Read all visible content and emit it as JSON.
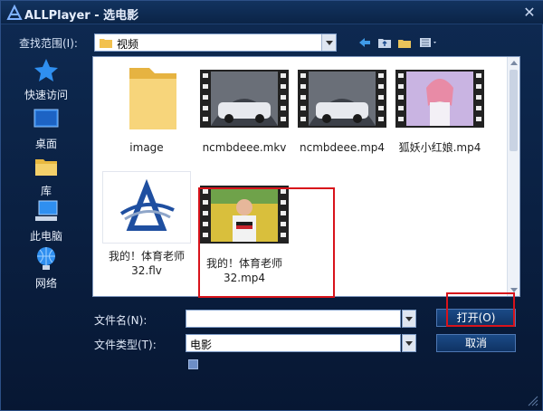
{
  "window": {
    "title": "ALLPlayer - 选电影"
  },
  "toolbar": {
    "look_in_label": "查找范围(I):",
    "current_folder": "视频"
  },
  "sidebar": {
    "items": [
      {
        "label": "快速访问",
        "icon": "star-icon"
      },
      {
        "label": "桌面",
        "icon": "desktop-icon"
      },
      {
        "label": "库",
        "icon": "library-icon"
      },
      {
        "label": "此电脑",
        "icon": "computer-icon"
      },
      {
        "label": "网络",
        "icon": "network-icon"
      }
    ]
  },
  "files": [
    {
      "name": "image",
      "type": "folder"
    },
    {
      "name": "ncmbdeee.mkv",
      "type": "video-car"
    },
    {
      "name": "ncmbdeee.mp4",
      "type": "video-car"
    },
    {
      "name": "狐妖小红娘.mp4",
      "type": "video-anime"
    },
    {
      "name_line1": "我的！体育老师",
      "name_line2": "32.flv",
      "type": "allplayer-file"
    },
    {
      "name_line1": "我的！体育老师",
      "name_line2": "32.mp4",
      "type": "video-person",
      "highlighted": true
    }
  ],
  "form": {
    "filename_label": "文件名(N):",
    "filename_value": "",
    "filetype_label": "文件类型(T):",
    "filetype_value": "电影",
    "open_button": "打开(O)",
    "cancel_button": "取消"
  },
  "colors": {
    "background": "#0b2040",
    "highlight": "#d8131b",
    "button": "#0f3364"
  }
}
